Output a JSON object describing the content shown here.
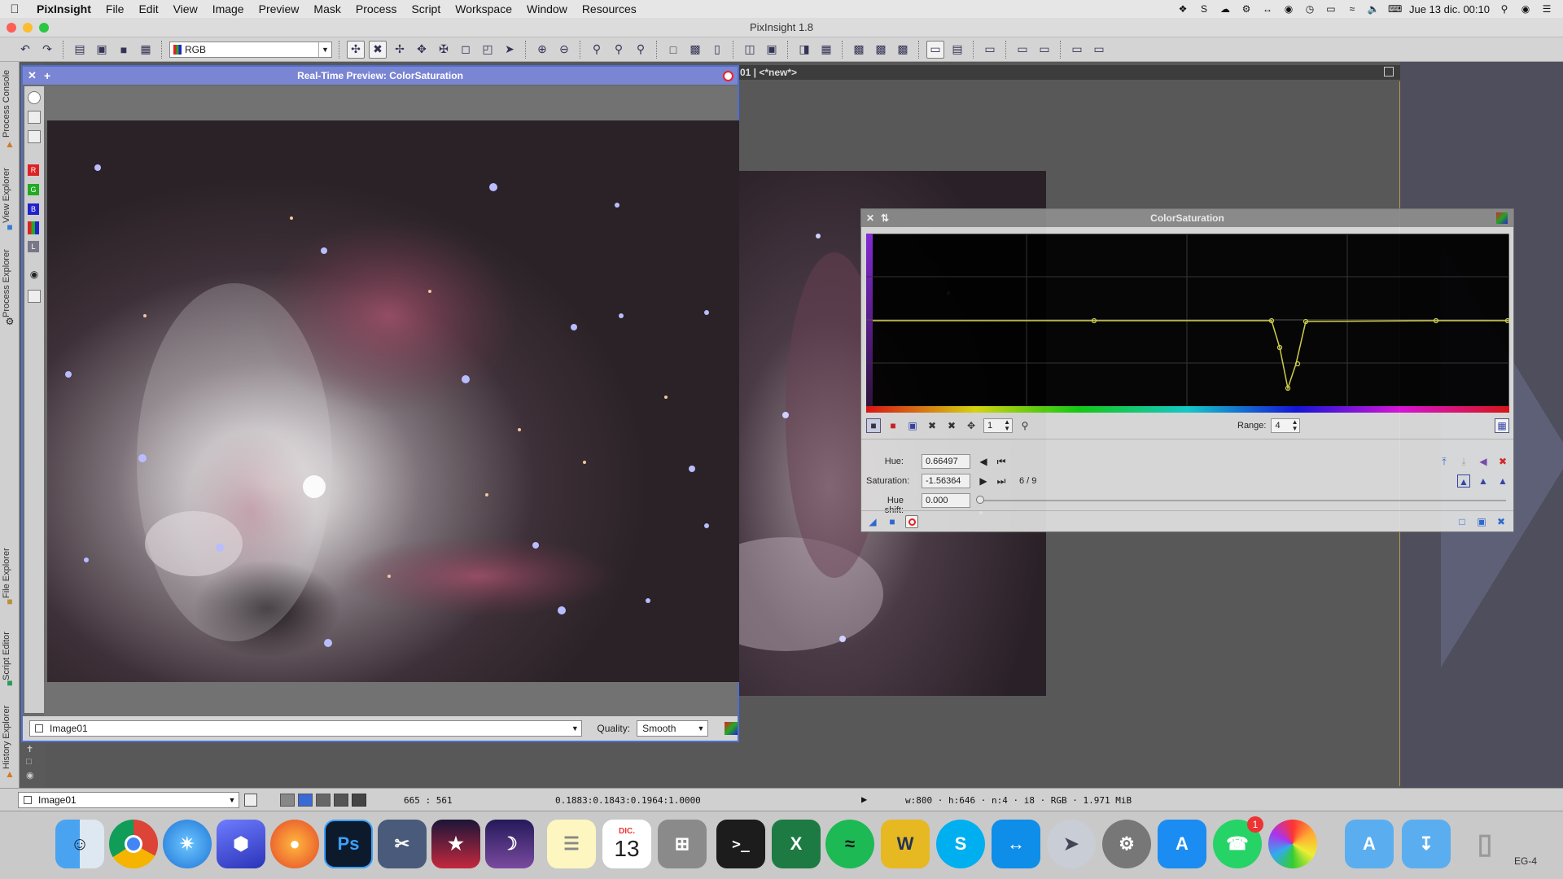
{
  "menubar": {
    "app_name": "PixInsight",
    "items": [
      "File",
      "Edit",
      "View",
      "Image",
      "Preview",
      "Mask",
      "Process",
      "Script",
      "Workspace",
      "Window",
      "Resources"
    ],
    "clock": "Jue 13 dic.  00:10"
  },
  "window": {
    "title": "PixInsight 1.8"
  },
  "toolbar": {
    "rgb_mode": "RGB"
  },
  "side_tabs": [
    "Process Console",
    "View Explorer",
    "Process Explorer",
    "File Explorer",
    "Script Editor",
    "History Explorer"
  ],
  "tool_strip": [
    "R",
    "G",
    "B",
    "RGB",
    "L"
  ],
  "preview_window": {
    "title": "Real-Time Preview: ColorSaturation",
    "view_select": "Image01",
    "quality_label": "Quality:",
    "quality_value": "Smooth"
  },
  "background_window": {
    "title": "01 | <*new*>"
  },
  "color_saturation": {
    "title": "ColorSaturation",
    "zoom_value": "1",
    "range_label": "Range:",
    "range_value": "4",
    "hue_label": "Hue:",
    "hue_value": "0.66497",
    "saturation_label": "Saturation:",
    "saturation_value": "-1.56364",
    "point_index": "6 / 9",
    "hue_shift_label": "Hue shift:",
    "hue_shift_value": "0.000"
  },
  "statusbar": {
    "view_select": "Image01",
    "cursor_coords": "665 : 561",
    "pixel_value": "0.1883:0.1843:0.1964:1.0000",
    "image_info": "w:800 · h:646 · n:4 · i8 · RGB · 1.971 MiB"
  },
  "dock": {
    "calendar_month": "DIC.",
    "calendar_day": "13",
    "whatsapp_badge": "1",
    "partial_label": "EG-4"
  },
  "colors": {
    "accent": "#4d6fd0",
    "curve": "#d8d64a"
  }
}
